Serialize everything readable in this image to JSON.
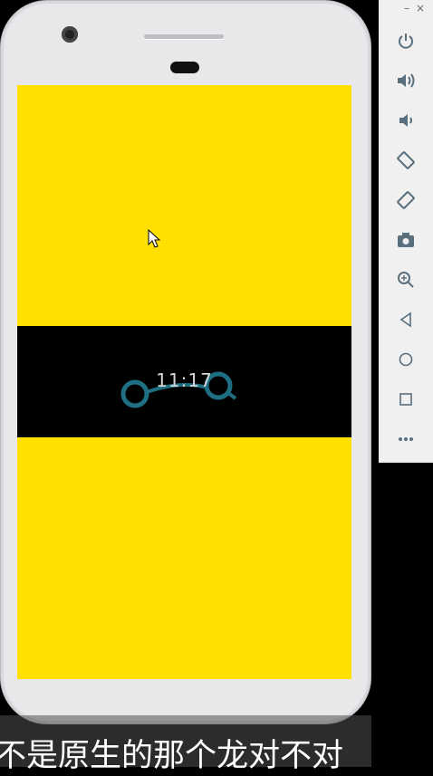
{
  "device": {
    "screen_color": "#ffe000",
    "band_color": "#000000",
    "accent_color": "#1f6f82"
  },
  "lockscreen": {
    "time": "11:17"
  },
  "emulator_toolbar": {
    "window_controls": [
      "–",
      "×"
    ],
    "buttons": [
      {
        "name": "power",
        "icon": "power-icon"
      },
      {
        "name": "volume-up",
        "icon": "volume-up-icon"
      },
      {
        "name": "volume-down",
        "icon": "volume-down-icon"
      },
      {
        "name": "rotate-left",
        "icon": "rotate-left-icon"
      },
      {
        "name": "rotate-right",
        "icon": "rotate-right-icon"
      },
      {
        "name": "screenshot",
        "icon": "camera-icon"
      },
      {
        "name": "zoom",
        "icon": "zoom-icon"
      },
      {
        "name": "back",
        "icon": "back-triangle-icon"
      },
      {
        "name": "home",
        "icon": "home-circle-icon"
      },
      {
        "name": "overview",
        "icon": "overview-square-icon"
      },
      {
        "name": "more",
        "icon": "more-dots-icon"
      }
    ]
  },
  "subtitle": {
    "text": "不是原生的那个龙对不对"
  }
}
